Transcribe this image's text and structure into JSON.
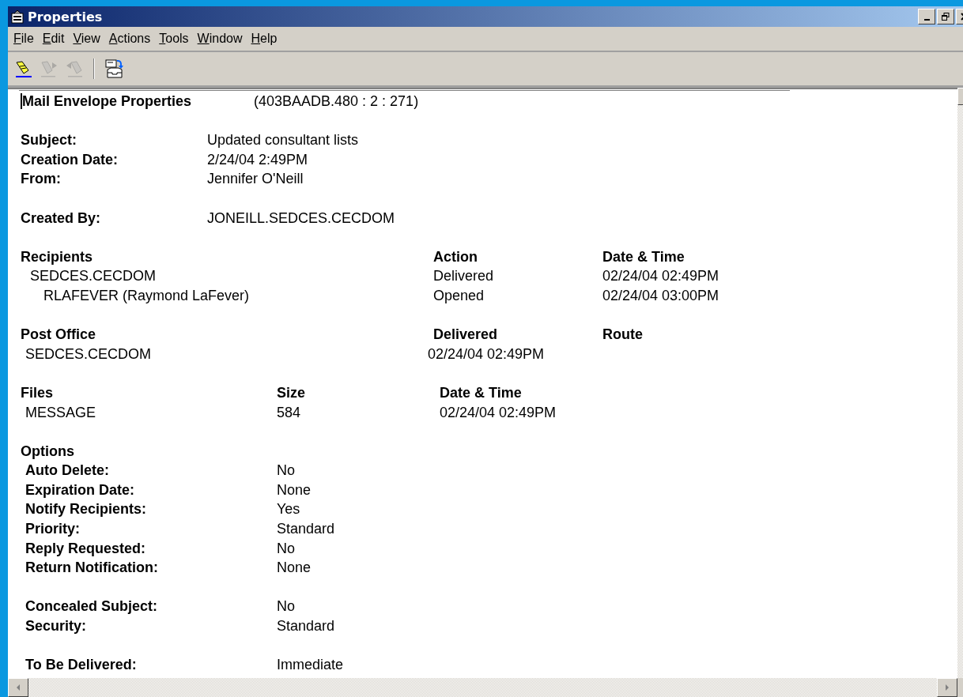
{
  "window": {
    "title": "Properties"
  },
  "menu": [
    {
      "label": "File"
    },
    {
      "label": "Edit"
    },
    {
      "label": "View"
    },
    {
      "label": "Actions"
    },
    {
      "label": "Tools"
    },
    {
      "label": "Window"
    },
    {
      "label": "Help"
    }
  ],
  "toolbar": [
    {
      "kind": "pen",
      "disabled": false
    },
    {
      "kind": "pen-next",
      "disabled": true
    },
    {
      "kind": "pen-prev",
      "disabled": true
    },
    {
      "kind": "separator"
    },
    {
      "kind": "inbox",
      "disabled": false
    }
  ],
  "header": {
    "title": "Mail Envelope Properties",
    "id": "(403BAADB.480 : 2 : 271)"
  },
  "message_fields": [
    {
      "label": "Subject:",
      "value": "Updated consultant lists"
    },
    {
      "label": "Creation Date:",
      "value": "2/24/04 2:49PM"
    },
    {
      "label": "From:",
      "value": "Jennifer O'Neill"
    }
  ],
  "created_by": {
    "label": "Created By:",
    "value": "JONEILL.SEDCES.CECDOM"
  },
  "recipients": {
    "columns": [
      "Recipients",
      "Action",
      "Date & Time"
    ],
    "rows": [
      {
        "name": "SEDCES.CECDOM",
        "action": "Delivered",
        "date": "02/24/04 02:49PM",
        "children": [
          {
            "name": "RLAFEVER (Raymond LaFever)",
            "action": "Opened",
            "date": "02/24/04 03:00PM"
          }
        ]
      }
    ]
  },
  "post_office": {
    "columns": [
      "Post Office",
      "Delivered",
      "Route"
    ],
    "rows": [
      {
        "post_office": "SEDCES.CECDOM",
        "delivered": "02/24/04 02:49PM"
      }
    ]
  },
  "files": {
    "columns": [
      "Files",
      "Size",
      "Date & Time"
    ],
    "rows": [
      {
        "file": "MESSAGE",
        "size": "584",
        "date": "02/24/04 02:49PM"
      }
    ]
  },
  "options": {
    "title": "Options",
    "groups": [
      [
        {
          "label": "Auto Delete:",
          "value": "No"
        },
        {
          "label": "Expiration Date:",
          "value": "None"
        },
        {
          "label": "Notify Recipients:",
          "value": "Yes"
        },
        {
          "label": "Priority:",
          "value": "Standard"
        },
        {
          "label": "Reply Requested:",
          "value": "No"
        },
        {
          "label": "Return Notification:",
          "value": "None"
        }
      ],
      [
        {
          "label": "Concealed Subject:",
          "value": "No"
        },
        {
          "label": "Security:",
          "value": "Standard"
        }
      ],
      [
        {
          "label": "To Be Delivered:",
          "value": "Immediate"
        }
      ]
    ]
  }
}
